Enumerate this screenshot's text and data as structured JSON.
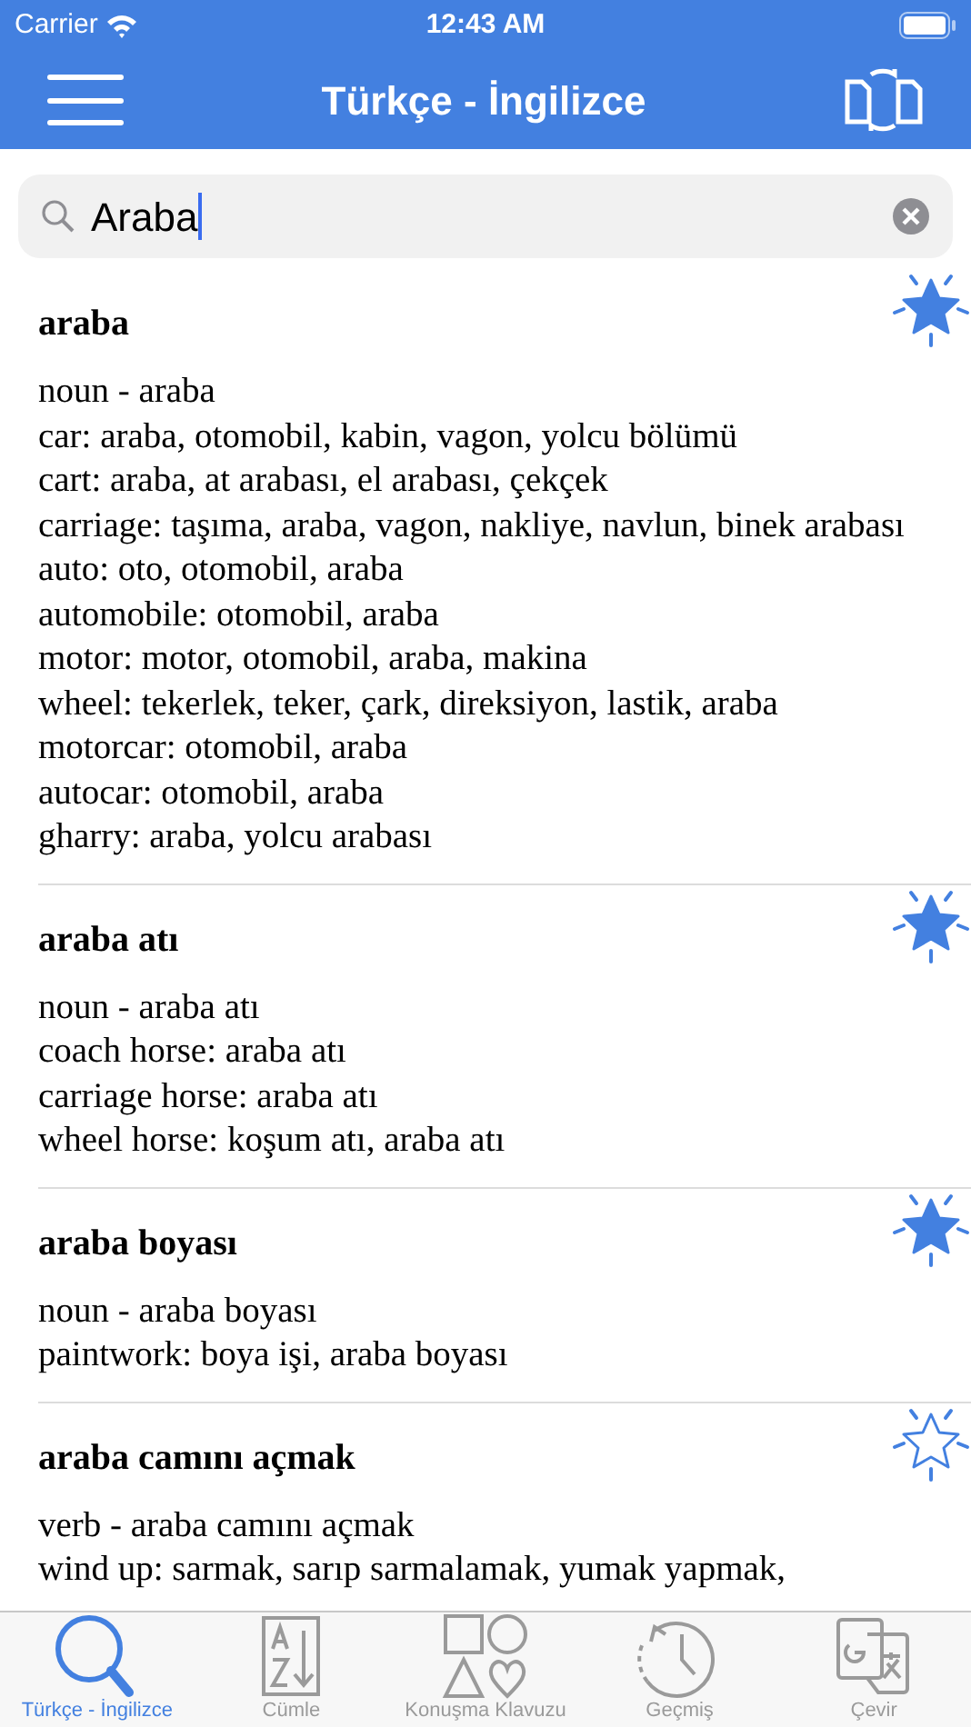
{
  "status_bar": {
    "carrier": "Carrier",
    "time": "12:43 AM"
  },
  "nav": {
    "title": "Türkçe - İngilizce"
  },
  "search": {
    "value": "Araba"
  },
  "entries": [
    {
      "headword": "araba",
      "favorite": true,
      "lines": [
        "noun - araba",
        "car: araba, otomobil, kabin, vagon, yolcu bölümü",
        "cart: araba, at arabası, el arabası, çekçek",
        "carriage: taşıma, araba, vagon, nakliye, navlun, binek arabası",
        "auto: oto, otomobil, araba",
        "automobile: otomobil, araba",
        "motor: motor, otomobil, araba, makina",
        "wheel: tekerlek, teker, çark, direksiyon, lastik, araba",
        "motorcar: otomobil, araba",
        "autocar: otomobil, araba",
        "gharry: araba, yolcu arabası"
      ]
    },
    {
      "headword": "araba atı",
      "favorite": true,
      "lines": [
        "noun - araba atı",
        "coach horse: araba atı",
        "carriage horse: araba atı",
        "wheel horse: koşum atı, araba atı"
      ]
    },
    {
      "headword": "araba boyası",
      "favorite": true,
      "lines": [
        "noun - araba boyası",
        "paintwork: boya işi, araba boyası"
      ]
    },
    {
      "headword": "araba camını açmak",
      "favorite": false,
      "lines": [
        "verb - araba camını açmak",
        "wind up: sarmak, sarıp sarmalamak, yumak yapmak,"
      ]
    }
  ],
  "tabs": [
    {
      "label": "Türkçe - İngilizce",
      "kind": "search",
      "selected": true
    },
    {
      "label": "Cümle",
      "kind": "sort",
      "selected": false
    },
    {
      "label": "Konuşma Klavuzu",
      "kind": "shapes",
      "selected": false
    },
    {
      "label": "Geçmiş",
      "kind": "history",
      "selected": false
    },
    {
      "label": "Çevir",
      "kind": "translate",
      "selected": false
    }
  ]
}
